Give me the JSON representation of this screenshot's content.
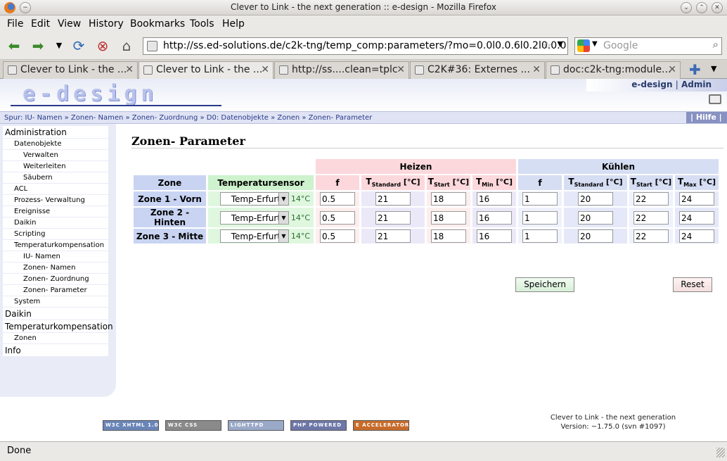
{
  "window": {
    "title": "Clever to Link - the next generation :: e-design - Mozilla Firefox"
  },
  "menu": [
    "File",
    "Edit",
    "View",
    "History",
    "Bookmarks",
    "Tools",
    "Help"
  ],
  "nav": {
    "url": "http://ss.ed-solutions.de/c2k-tng/temp_comp:parameters/?mo=0.0l0.0.6l0.2l0.0.0",
    "search_placeholder": "Google"
  },
  "tabs": [
    {
      "label": "Clever to Link - the ..."
    },
    {
      "label": "Clever to Link - the ..."
    },
    {
      "label": "http://ss....clean=tplc"
    },
    {
      "label": "C2K#36: Externes ..."
    },
    {
      "label": "doc:c2k-tng:module..."
    }
  ],
  "header": {
    "logo": "e-design",
    "user": "e-design",
    "sep": "|",
    "role": "Admin"
  },
  "breadcrumb": {
    "text": "Spur: IU- Namen » Zonen- Namen » Zonen- Zuordnung » D0: Datenobjekte » Zonen » Zonen- Parameter",
    "help": "| Hilfe |"
  },
  "sidebar": {
    "items": [
      {
        "label": "Administration",
        "level": 1
      },
      {
        "label": "Datenobjekte",
        "level": 2
      },
      {
        "label": "Verwalten",
        "level": 3
      },
      {
        "label": "Weiterleiten",
        "level": 3
      },
      {
        "label": "Säubern",
        "level": 3
      },
      {
        "label": "ACL",
        "level": 2
      },
      {
        "label": "Prozess- Verwaltung",
        "level": 2
      },
      {
        "label": "Ereignisse",
        "level": 2
      },
      {
        "label": "Daikin",
        "level": 2
      },
      {
        "label": "Scripting",
        "level": 2
      },
      {
        "label": "Temperaturkompensation",
        "level": 2
      },
      {
        "label": "IU- Namen",
        "level": 3
      },
      {
        "label": "Zonen- Namen",
        "level": 3
      },
      {
        "label": "Zonen- Zuordnung",
        "level": 3
      },
      {
        "label": "Zonen- Parameter",
        "level": 3
      },
      {
        "label": "System",
        "level": 2
      },
      {
        "label": "Daikin",
        "level": 1
      },
      {
        "label": "Temperaturkompensation",
        "level": 1
      },
      {
        "label": "Zonen",
        "level": 2
      },
      {
        "label": "Info",
        "level": 1
      }
    ]
  },
  "page": {
    "title": "Zonen- Parameter",
    "groups": {
      "heat": "Heizen",
      "cool": "Kühlen"
    },
    "headers": {
      "zone": "Zone",
      "sensor": "Temperatursensor",
      "heat": [
        {
          "main": "f",
          "sub": "",
          "unit": ""
        },
        {
          "main": "T",
          "sub": "Standard",
          "unit": " [°C]"
        },
        {
          "main": "T",
          "sub": "Start",
          "unit": " [°C]"
        },
        {
          "main": "T",
          "sub": "Min",
          "unit": " [°C]"
        }
      ],
      "cool": [
        {
          "main": "f",
          "sub": "",
          "unit": ""
        },
        {
          "main": "T",
          "sub": "Standard",
          "unit": " [°C]"
        },
        {
          "main": "T",
          "sub": "Start",
          "unit": " [°C]"
        },
        {
          "main": "T",
          "sub": "Max",
          "unit": " [°C]"
        }
      ]
    },
    "rows": [
      {
        "zone": "Zone 1 - Vorn",
        "sensor": "Temp-Erfurt",
        "temp": "14°C",
        "heat": [
          "0.5",
          "21",
          "18",
          "16"
        ],
        "cool": [
          "1",
          "20",
          "22",
          "24"
        ]
      },
      {
        "zone": "Zone 2 - Hinten",
        "sensor": "Temp-Erfurt",
        "temp": "14°C",
        "heat": [
          "0.5",
          "21",
          "18",
          "16"
        ],
        "cool": [
          "1",
          "20",
          "22",
          "24"
        ]
      },
      {
        "zone": "Zone 3 - Mitte",
        "sensor": "Temp-Erfurt",
        "temp": "14°C",
        "heat": [
          "0.5",
          "21",
          "18",
          "16"
        ],
        "cool": [
          "1",
          "20",
          "22",
          "24"
        ]
      }
    ],
    "save": "Speichern",
    "reset": "Reset"
  },
  "footer": {
    "badges": [
      {
        "label": "W3C XHTML 1.0",
        "name": "badge-xhtml",
        "color": "#6a86b8"
      },
      {
        "label": "W3C CSS",
        "name": "badge-css",
        "color": "#8a8a8a"
      },
      {
        "label": "LIGHTTPD",
        "name": "badge-lighttpd",
        "color": "#9aa9c8"
      },
      {
        "label": "PHP POWERED",
        "name": "badge-php",
        "color": "#6d77a8"
      },
      {
        "label": "E ACCELERATOR",
        "name": "badge-eaccelerator",
        "color": "#c86b2a"
      }
    ],
    "line1": "Clever to Link - the next generation",
    "line2": "Version: ~1.75.0 (svn #1097)"
  },
  "status": "Done"
}
